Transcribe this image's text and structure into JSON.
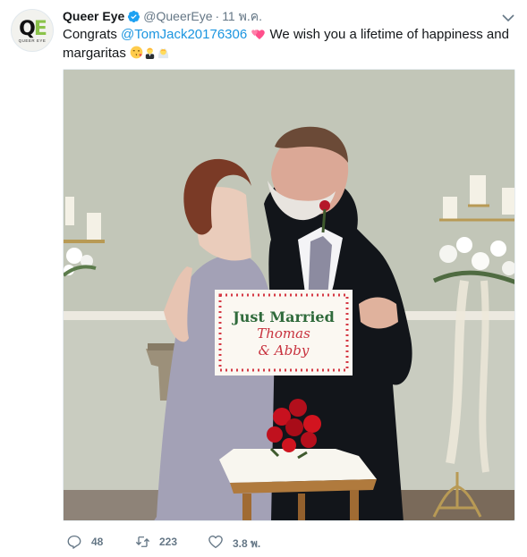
{
  "tweet": {
    "display_name": "Queer Eye",
    "handle": "@QueerEye",
    "separator": "·",
    "timestamp": "11 พ.ค.",
    "avatar_text": "QUEER EYE",
    "text_prefix": "Congrats ",
    "mention": "@TomJack20176306",
    "text_middle": " We wish you a lifetime of happiness and margaritas ",
    "emojis": [
      "two-hearts",
      "face-blowing-kiss",
      "man-in-tuxedo",
      "bride-with-veil"
    ],
    "media": {
      "sign_line1": "Just Married",
      "sign_line2": "Thomas",
      "sign_line3": "& Abby"
    }
  },
  "actions": {
    "reply_count": "48",
    "retweet_count": "223",
    "like_count": "3.8 พ."
  },
  "colors": {
    "mention": "#1b95e0",
    "verified": "#1da1f2",
    "meta": "#657786",
    "text": "#14171a"
  }
}
